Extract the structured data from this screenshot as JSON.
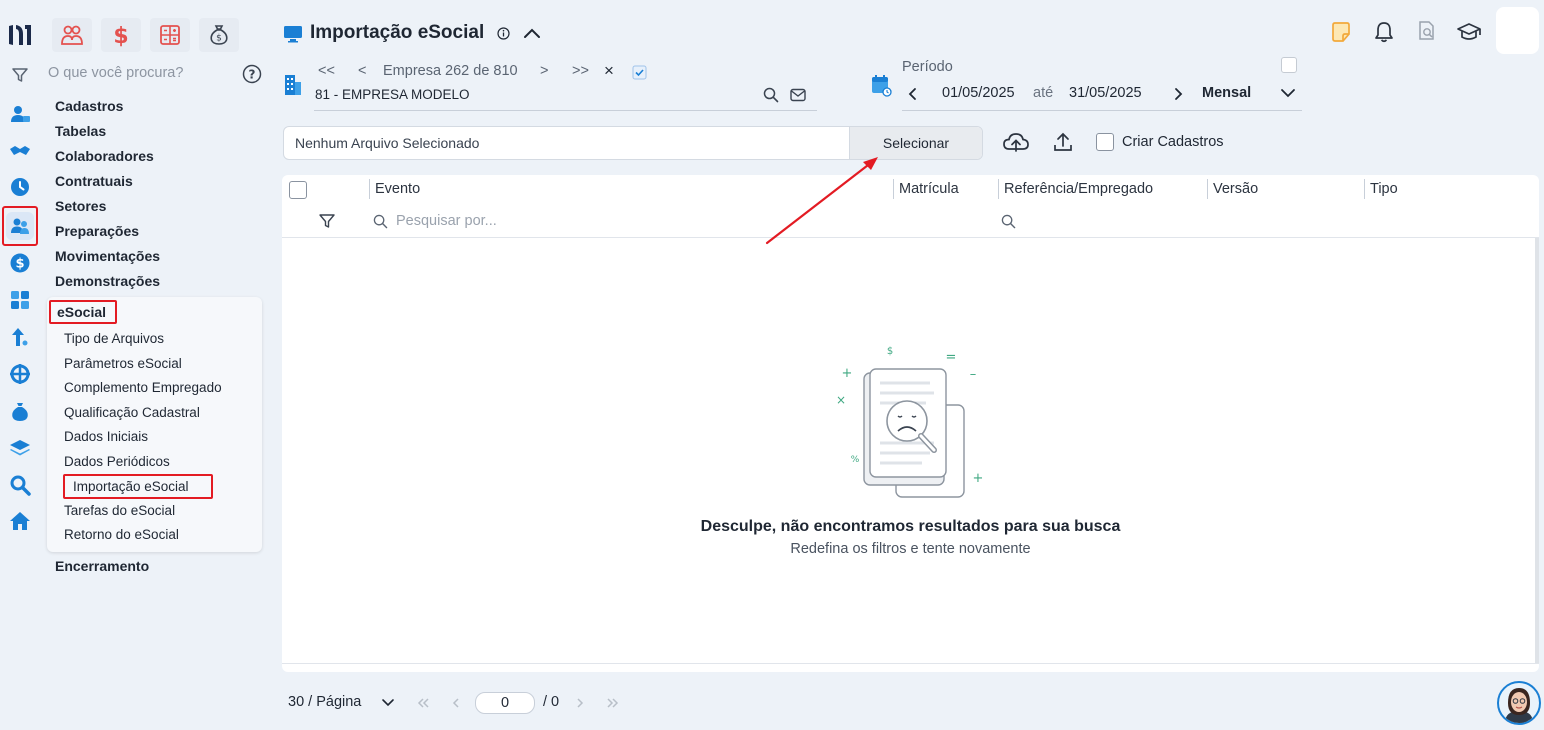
{
  "search": {
    "placeholder": "O que você procura?"
  },
  "menu": {
    "sections": [
      "Cadastros",
      "Tabelas",
      "Colaboradores",
      "Contratuais",
      "Setores",
      "Preparações",
      "Movimentações",
      "Demonstrações"
    ],
    "active_section": "eSocial",
    "submenu": [
      "Tipo de Arquivos",
      "Parâmetros eSocial",
      "Complemento Empregado",
      "Qualificação Cadastral",
      "Dados Iniciais",
      "Dados Periódicos",
      "Importação eSocial",
      "Tarefas do eSocial",
      "Retorno do eSocial"
    ],
    "last_section": "Encerramento"
  },
  "page": {
    "title": "Importação eSocial",
    "nav": {
      "first": "<<",
      "prev": "<",
      "company_label": "Empresa 262 de 810",
      "next": ">",
      "last": ">>",
      "close": "×"
    },
    "company": "81 - EMPRESA MODELO",
    "period": {
      "label": "Período",
      "start": "01/05/2025",
      "until": "até",
      "end": "31/05/2025",
      "mode": "Mensal"
    }
  },
  "file": {
    "value": "Nenhum Arquivo Selecionado",
    "select_label": "Selecionar",
    "create_label": "Criar Cadastros"
  },
  "grid": {
    "columns": [
      "Evento",
      "Matrícula",
      "Referência/Empregado",
      "Versão",
      "Tipo"
    ],
    "search_placeholder": "Pesquisar por...",
    "empty_title": "Desculpe, não encontramos resultados para sua busca",
    "empty_sub": "Redefina os filtros e tente novamente",
    "illustration_symbols": {
      "dollar": "$",
      "equals": "=",
      "plus": "+",
      "minus": "–",
      "times": "×",
      "percent": "%"
    }
  },
  "pager": {
    "per_page": "30 / Página",
    "current": "0",
    "total": "/ 0"
  },
  "colors": {
    "accent": "#1a7fd4",
    "highlight": "#e31b23",
    "arrow": "#e31b23",
    "module_icon": "#e4524f",
    "notification": "#f2a93b"
  }
}
